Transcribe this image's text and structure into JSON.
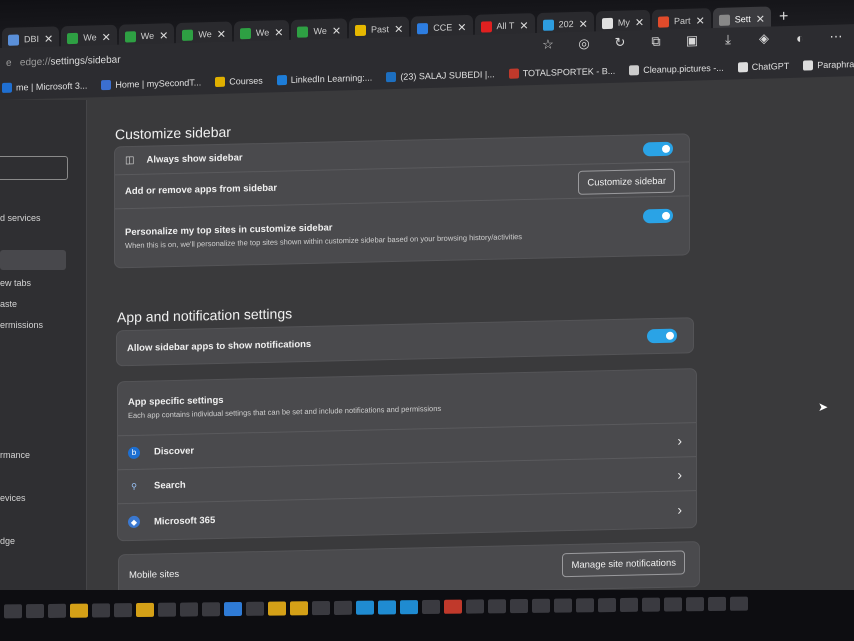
{
  "tabs": [
    {
      "label": "DBI",
      "color": "#5a8fd8"
    },
    {
      "label": "We",
      "color": "#2ea043"
    },
    {
      "label": "We",
      "color": "#2ea043"
    },
    {
      "label": "We",
      "color": "#2ea043"
    },
    {
      "label": "We",
      "color": "#2ea043"
    },
    {
      "label": "We",
      "color": "#2ea043"
    },
    {
      "label": "Past",
      "color": "#e6b800"
    },
    {
      "label": "CCE",
      "color": "#2d7de0"
    },
    {
      "label": "All T",
      "color": "#e02020"
    },
    {
      "label": "202",
      "color": "#2d9de0"
    },
    {
      "label": "My",
      "color": "#e0e0e0"
    },
    {
      "label": "Part",
      "color": "#e04b2b"
    },
    {
      "label": "Sett",
      "color": "#888888",
      "active": true
    }
  ],
  "address": {
    "prefix": "edge://",
    "path": "settings/sidebar",
    "leading": "e"
  },
  "favorites": [
    {
      "label": "me | Microsoft 3...",
      "color": "#1f6fd1"
    },
    {
      "label": "Home | mySecondT...",
      "color": "#3b6fd1"
    },
    {
      "label": "Courses",
      "color": "#e0b000"
    },
    {
      "label": "LinkedIn Learning:...",
      "color": "#1d7dd8"
    },
    {
      "label": "(23) SALAJ SUBEDI |...",
      "color": "#1d6fc0"
    },
    {
      "label": "TOTALSPORTEK - B...",
      "color": "#c0392b"
    },
    {
      "label": "Cleanup.pictures -...",
      "color": "#cccccc"
    },
    {
      "label": "ChatGPT",
      "color": "#dddddd"
    },
    {
      "label": "Paraphrasing Tool |...",
      "color": "#dddddd"
    }
  ],
  "nav": {
    "items": [
      "d services",
      "ew tabs",
      "aste",
      "ermissions",
      "rmance",
      "evices",
      "dge"
    ]
  },
  "customize": {
    "title": "Customize sidebar",
    "always_show": "Always show sidebar",
    "add_remove": "Add or remove apps from sidebar",
    "customize_button": "Customize sidebar",
    "personalize": "Personalize my top sites in customize sidebar",
    "personalize_sub": "When this is on, we'll personalize the top sites shown within customize sidebar based on your browsing history/activities"
  },
  "notifications": {
    "title": "App and notification settings",
    "allow": "Allow sidebar apps to show notifications",
    "app_specific": "App specific settings",
    "app_specific_sub": "Each app contains individual settings that can be set and include notifications and permissions",
    "apps": [
      "Discover",
      "Search",
      "Microsoft 365"
    ],
    "mobile_sites": "Mobile sites",
    "manage_button": "Manage site notifications"
  },
  "colors": {
    "accent": "#2aa3e6",
    "card": "#4a4a4d",
    "background": "#3a3a3c"
  }
}
